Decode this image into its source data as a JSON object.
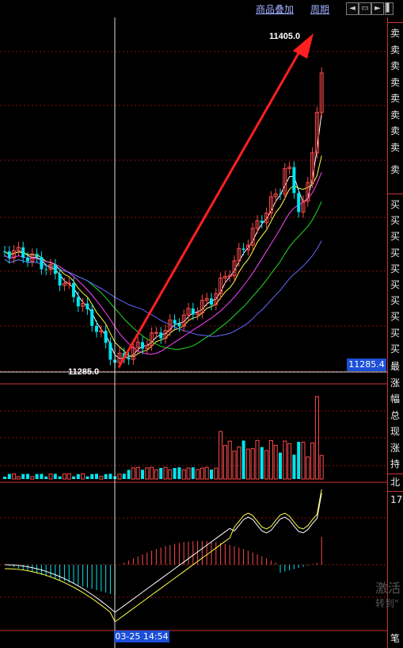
{
  "toolbar": {
    "overlay_label": "商品叠加",
    "period_label": "周期",
    "nav_icons": [
      "left-arrow-icon",
      "window-icon",
      "right-arrow-icon",
      "fullscreen-icon"
    ]
  },
  "chart": {
    "high_label": "11405.0",
    "low_label": "11285.0",
    "current_price": "11285.4",
    "crosshair_time": "03-25 14:54",
    "colors": {
      "up": "#ff4a4a",
      "down": "#00e5ee",
      "ma1": "#ffffff",
      "ma2": "#ffff44",
      "ma3": "#ff44ff",
      "ma4": "#22dd22",
      "ma5": "#6666ff",
      "arrow": "#ff2020",
      "grid": "#8a1010"
    }
  },
  "chart_data": {
    "type": "line",
    "price_high": 11405.0,
    "price_low": 11285.0,
    "ylim": [
      11265,
      11415
    ]
  },
  "right_panel": {
    "sell_items": [
      "卖",
      "卖",
      "卖",
      "卖",
      "卖",
      "卖",
      "卖",
      "卖",
      "卖"
    ],
    "buy_items": [
      "买",
      "买",
      "买",
      "买",
      "买",
      "买",
      "买",
      "买",
      "买",
      "买"
    ],
    "stats": [
      "最",
      "涨",
      "幅",
      "总",
      "现",
      "涨",
      "持"
    ],
    "north_label": "北",
    "num_label": "17",
    "bottom_label": "笔"
  },
  "watermark": {
    "line1": "激活",
    "line2": "转到\""
  }
}
